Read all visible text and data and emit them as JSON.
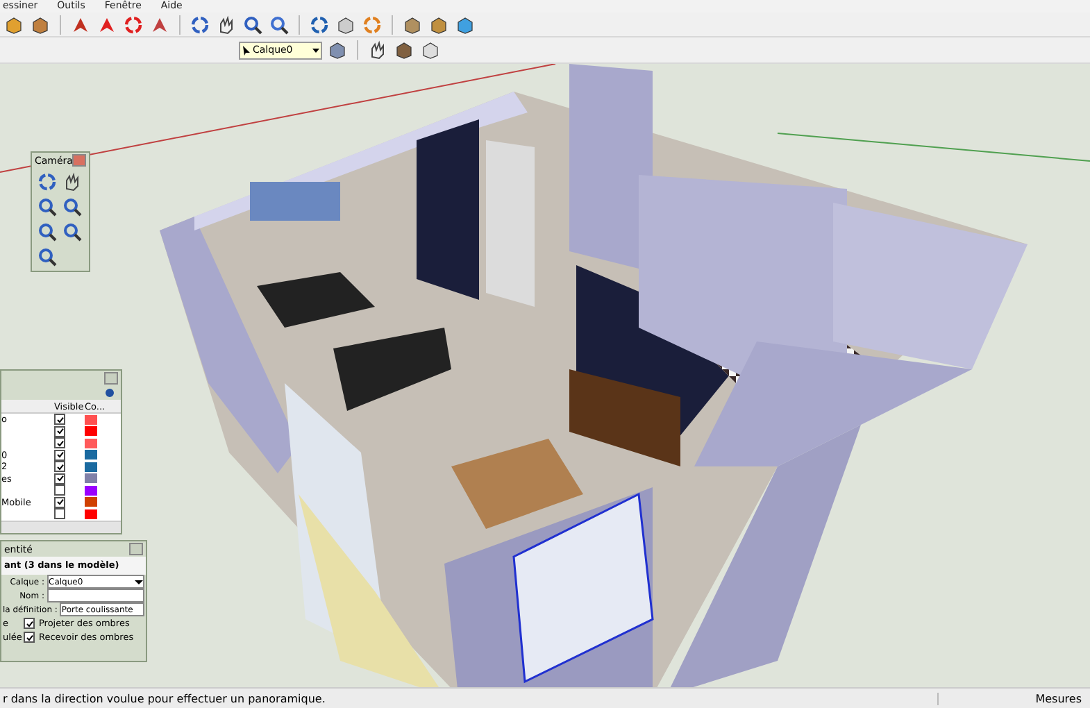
{
  "menu": [
    "essiner",
    "Outils",
    "Fenêtre",
    "Aide"
  ],
  "layer_selector": {
    "value": "Calque0"
  },
  "camera_palette": {
    "title": "Caméra"
  },
  "layers_panel": {
    "columns": [
      "Visible",
      "Co..."
    ],
    "rows": [
      {
        "name": "o",
        "visible": true,
        "color": "#ff5050"
      },
      {
        "visible": true,
        "color": "#ff0000"
      },
      {
        "visible": true,
        "color": "#ff5a5a"
      },
      {
        "name": "0",
        "visible": true,
        "color": "#1a6aa0"
      },
      {
        "name": "2",
        "visible": true,
        "color": "#1a6aa0"
      },
      {
        "name": "es",
        "visible": true,
        "color": "#8080a8"
      },
      {
        "visible": false,
        "color": "#9a00ff"
      },
      {
        "name": "Mobile",
        "visible": true,
        "color": "#d04000"
      },
      {
        "visible": false,
        "color": "#ff0000"
      }
    ]
  },
  "entity_info": {
    "title": "entité",
    "heading": "ant (3 dans le modèle)",
    "fields": [
      {
        "label": "Calque :",
        "value": "Calque0",
        "kind": "select"
      },
      {
        "label": "Nom :",
        "kind": "text"
      },
      {
        "label": "la définition :",
        "value": "Porte coulissante",
        "kind": "text"
      }
    ],
    "left_labels": [
      "e",
      "ulée"
    ],
    "shadows": [
      {
        "label": "Projeter des ombres",
        "checked": true
      },
      {
        "label": "Recevoir des ombres",
        "checked": true
      }
    ]
  },
  "status_bar": {
    "message": "r dans la direction voulue pour effectuer un panoramique.",
    "measure_label": "Mesures"
  }
}
